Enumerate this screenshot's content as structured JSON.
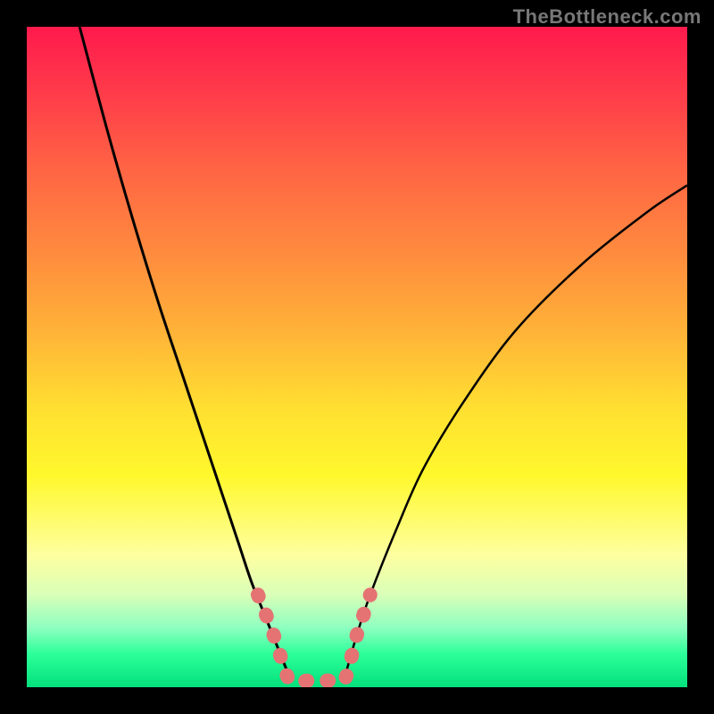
{
  "watermark": "TheBottleneck.com",
  "chart_data": {
    "type": "line",
    "title": "",
    "xlabel": "",
    "ylabel": "",
    "xlim": [
      0,
      100
    ],
    "ylim": [
      0,
      100
    ],
    "series": [
      {
        "name": "left-curve",
        "x": [
          8,
          12,
          16,
          20,
          24,
          28,
          30,
          32,
          34,
          36,
          38,
          40
        ],
        "y": [
          100,
          85,
          71,
          58,
          46,
          34,
          28,
          22,
          16,
          11,
          6,
          1
        ]
      },
      {
        "name": "right-curve",
        "x": [
          48,
          50,
          52,
          56,
          60,
          66,
          74,
          84,
          94,
          100
        ],
        "y": [
          1,
          8,
          14,
          24,
          33,
          43,
          54,
          64,
          72,
          76
        ]
      },
      {
        "name": "valley-marker",
        "x": [
          35,
          37,
          38,
          39,
          40,
          43,
          46,
          48,
          49,
          50,
          51,
          52
        ],
        "y": [
          14,
          9,
          6,
          3,
          1,
          1,
          1,
          1,
          4,
          8,
          11,
          14
        ]
      }
    ],
    "marker_color": "#e57373",
    "curve_color": "#000000"
  }
}
